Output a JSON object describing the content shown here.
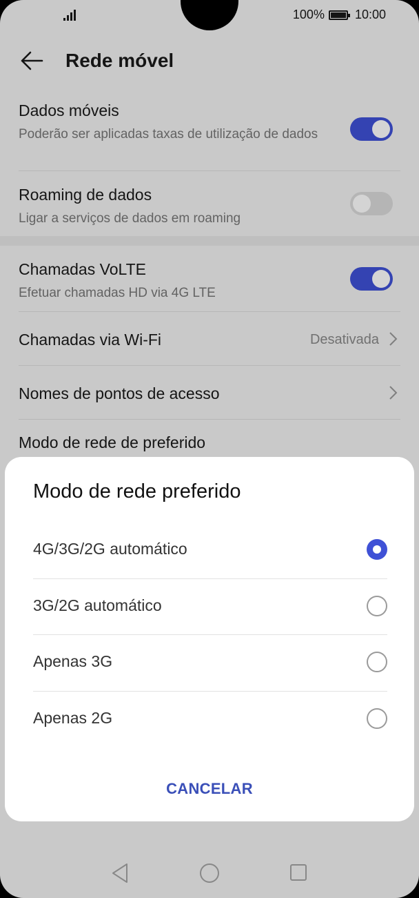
{
  "status_bar": {
    "battery": "100%",
    "time": "10:00"
  },
  "header": {
    "title": "Rede móvel"
  },
  "settings": {
    "mobile_data": {
      "title": "Dados móveis",
      "subtitle": "Poderão ser aplicadas taxas de utilização de dados",
      "enabled": true
    },
    "data_roaming": {
      "title": "Roaming de dados",
      "subtitle": "Ligar a serviços de dados em roaming",
      "enabled": false
    },
    "volte": {
      "title": "Chamadas VoLTE",
      "subtitle": "Efetuar chamadas HD via 4G LTE",
      "enabled": true
    },
    "wifi_calling": {
      "title": "Chamadas via Wi-Fi",
      "value": "Desativada"
    },
    "apn": {
      "title": "Nomes de pontos de acesso"
    },
    "network_mode": {
      "title": "Modo de rede de preferido"
    }
  },
  "dialog": {
    "title": "Modo de rede preferido",
    "options": [
      {
        "label": "4G/3G/2G automático",
        "selected": true
      },
      {
        "label": "3G/2G automático",
        "selected": false
      },
      {
        "label": "Apenas 3G",
        "selected": false
      },
      {
        "label": "Apenas 2G",
        "selected": false
      }
    ],
    "cancel_label": "CANCELAR"
  },
  "colors": {
    "accent": "#3f51d6",
    "cancel_text": "#3a4fb8"
  }
}
